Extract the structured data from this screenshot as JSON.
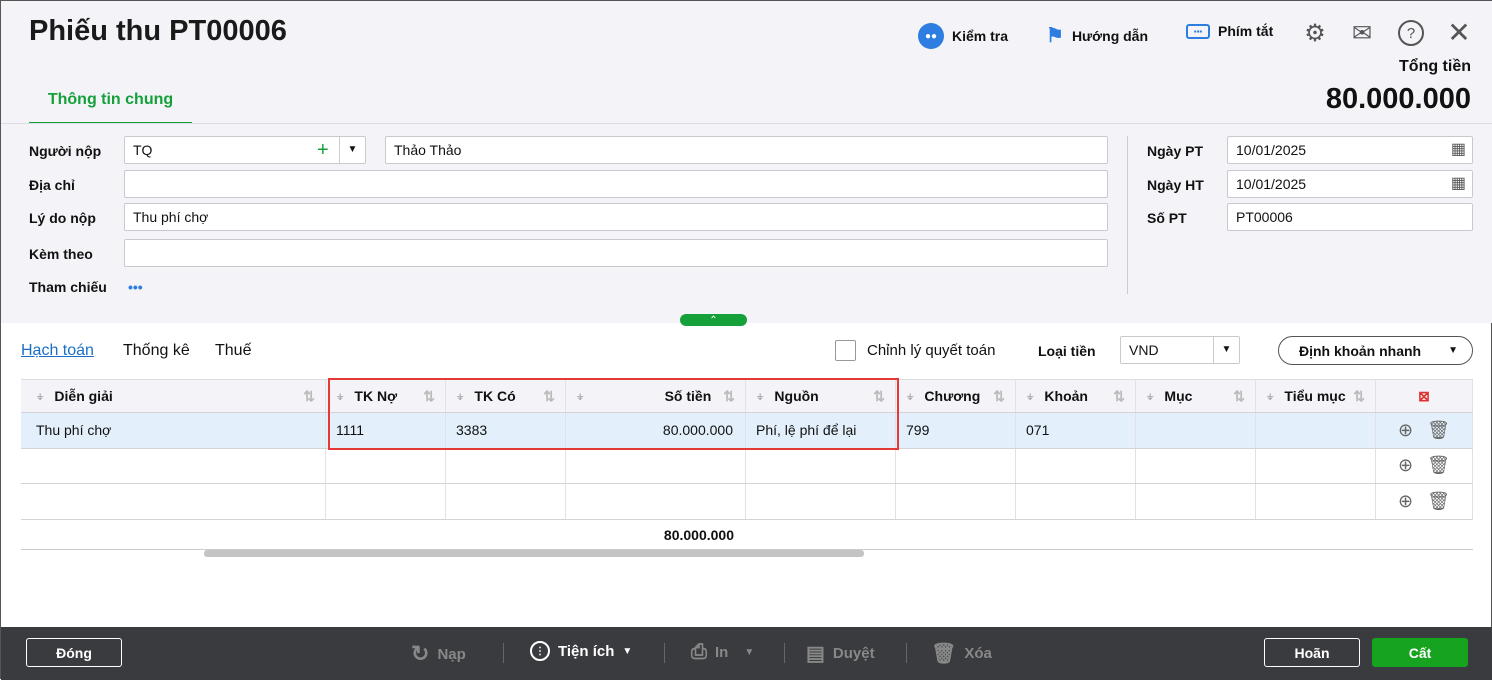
{
  "header": {
    "title": "Phiếu thu PT00006",
    "check": "Kiểm tra",
    "guide": "Hướng dẫn",
    "shortcuts": "Phím tắt",
    "total_label": "Tổng tiền",
    "total_value": "80.000.000"
  },
  "tabs": {
    "general": "Thông tin chung"
  },
  "form": {
    "payer_label": "Người nộp",
    "payer_code": "TQ",
    "payer_name": "Thảo Thảo",
    "address_label": "Địa chỉ",
    "address": "",
    "reason_label": "Lý do nộp",
    "reason": "Thu phí chợ",
    "attach_label": "Kèm theo",
    "attach": "",
    "ref_label": "Tham chiếu",
    "ref_more": "•••",
    "date_pt_label": "Ngày PT",
    "date_pt": "10/01/2025",
    "date_ht_label": "Ngày HT",
    "date_ht": "10/01/2025",
    "no_label": "Số PT",
    "no": "PT00006"
  },
  "detail_tabs": [
    "Hạch toán",
    "Thống kê",
    "Thuế"
  ],
  "options": {
    "settle_label": "Chỉnh lý quyết toán",
    "currency_label": "Loại tiền",
    "currency": "VND",
    "quick_entry": "Định khoản nhanh"
  },
  "table": {
    "columns": [
      "Diễn giải",
      "TK Nợ",
      "TK Có",
      "Số tiền",
      "Nguồn",
      "Chương",
      "Khoản",
      "Mục",
      "Tiểu mục"
    ],
    "rows": [
      [
        "Thu phí chợ",
        "1111",
        "3383",
        "80.000.000",
        "Phí, lệ phí để lại",
        "799",
        "071",
        "",
        ""
      ],
      [
        "",
        "",
        "",
        "",
        "",
        "",
        "",
        "",
        ""
      ],
      [
        "",
        "",
        "",
        "",
        "",
        "",
        "",
        "",
        ""
      ]
    ],
    "total": "80.000.000"
  },
  "footer": {
    "close": "Đóng",
    "reload": "Nạp",
    "utilities": "Tiện ích",
    "print": "In",
    "approve": "Duyệt",
    "delete": "Xóa",
    "cancel": "Hoãn",
    "save": "Cất"
  },
  "colors": {
    "green": "#15a03a",
    "highlight": "#e53935",
    "row_selected": "#e3f0fb"
  }
}
